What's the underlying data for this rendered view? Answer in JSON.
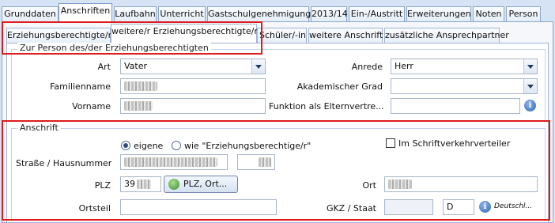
{
  "top_tabs": [
    "Grunddaten",
    "Anschriften",
    "Laufbahn",
    "Unterricht",
    "Gastschulgenehmigung",
    "2013/14",
    "Ein-/Austritt",
    "Erweiterungen",
    "Noten",
    "Person"
  ],
  "sub_tabs": [
    "Erziehungsberechtigte/r",
    "weitere/r Erziehungsberechtigte/r",
    "Schüler/-in",
    "weitere Anschrift",
    "zusätzliche Ansprechpartner"
  ],
  "person_group": {
    "title": "Zur Person des/der Erziehungsberechtigten",
    "art_label": "Art",
    "art_value": "Vater",
    "anrede_label": "Anrede",
    "anrede_value": "Herr",
    "familienname_label": "Familienname",
    "akad_grad_label": "Akademischer Grad",
    "akad_grad_value": "",
    "vorname_label": "Vorname",
    "funktion_label": "Funktion als Elternvertre..."
  },
  "address_group": {
    "title": "Anschrift",
    "radio_eigene": "eigene",
    "radio_wie": "wie \"Erziehungsberechtige/r\"",
    "schriftverkehr_label": "Im Schriftverkehrverteiler",
    "strasse_label": "Straße / Hausnummer",
    "plz_label": "PLZ",
    "plz_value": "39",
    "plz_button": "PLZ, Ort...",
    "ort_label": "Ort",
    "ortsteil_label": "Ortsteil",
    "gkz_label": "GKZ / Staat",
    "staat_code": "D",
    "staat_name": "Deutschl..."
  },
  "colors": {
    "highlight": "#e01b1b",
    "background": "#d6e3f4"
  }
}
